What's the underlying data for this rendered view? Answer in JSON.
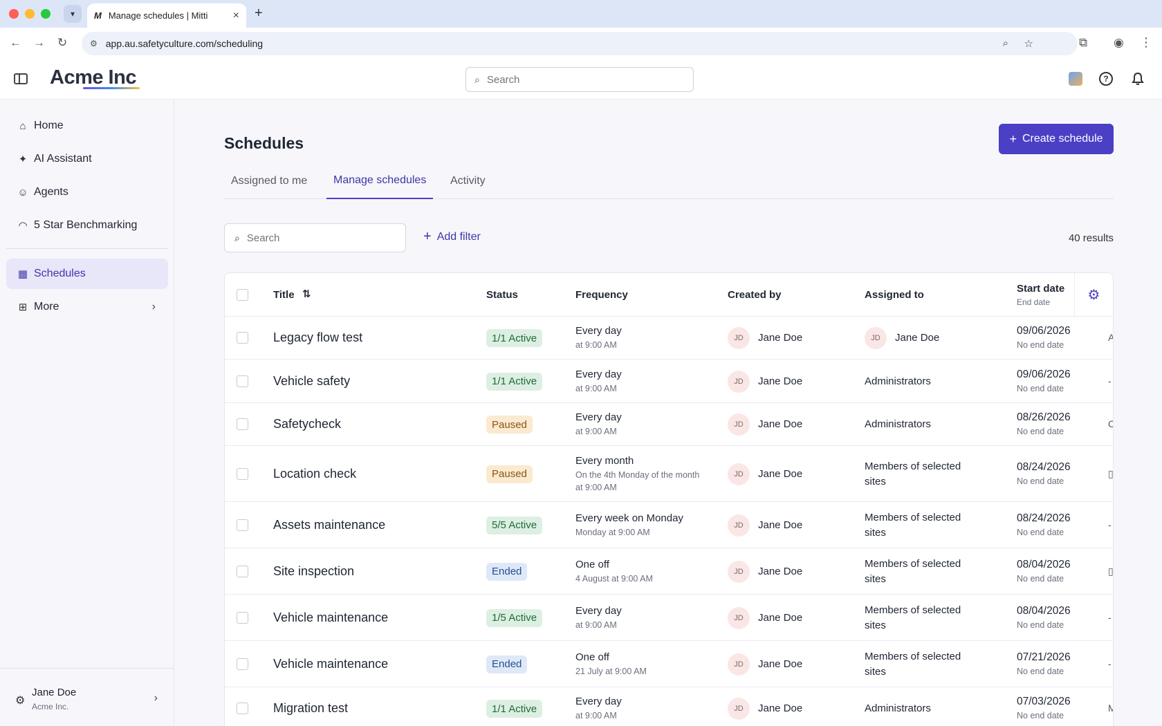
{
  "browser": {
    "tab_title": "Manage schedules | Mitti",
    "tab_favicon": "M",
    "url": "app.au.safetyculture.com/scheduling"
  },
  "app": {
    "logo": "Acme Inc",
    "search_placeholder": "Search"
  },
  "sidebar": {
    "items": [
      {
        "label": "Home",
        "icon": "home-icon"
      },
      {
        "label": "AI Assistant",
        "icon": "sparkle-icon"
      },
      {
        "label": "Agents",
        "icon": "robot-icon"
      },
      {
        "label": "5 Star Benchmarking",
        "icon": "gauge-icon"
      },
      {
        "label": "Schedules",
        "icon": "calendar-icon"
      },
      {
        "label": "More",
        "icon": "grid-icon"
      }
    ],
    "user": {
      "name": "Jane Doe",
      "org": "Acme Inc."
    }
  },
  "main": {
    "title": "Schedules",
    "create_label": "Create schedule",
    "tabs": [
      "Assigned to me",
      "Manage schedules",
      "Activity"
    ],
    "active_tab": "Manage schedules",
    "search_placeholder": "Search",
    "add_filter_label": "Add filter",
    "results": "40 results"
  },
  "table": {
    "headers": {
      "title": "Title",
      "status": "Status",
      "frequency": "Frequency",
      "created_by": "Created by",
      "assigned_to": "Assigned to",
      "start_date": "Start date",
      "end_date": "End date"
    },
    "rows": [
      {
        "title": "Legacy flow test",
        "status": "1/1 Active",
        "status_type": "active",
        "freq": "Every day",
        "freq_sub": "at 9:00 AM",
        "creator_initials": "JD",
        "creator": "Jane Doe",
        "assigned_initials": "JD",
        "assigned": "Jane Doe",
        "start": "09/06/2026",
        "end": "No end date",
        "overflow": "A"
      },
      {
        "title": "Vehicle safety",
        "status": "1/1 Active",
        "status_type": "active",
        "freq": "Every day",
        "freq_sub": "at 9:00 AM",
        "creator_initials": "JD",
        "creator": "Jane Doe",
        "assigned": "Administrators",
        "start": "09/06/2026",
        "end": "No end date",
        "overflow": "-"
      },
      {
        "title": "Safetycheck",
        "status": "Paused",
        "status_type": "paused",
        "freq": "Every day",
        "freq_sub": "at 9:00 AM",
        "creator_initials": "JD",
        "creator": "Jane Doe",
        "assigned": "Administrators",
        "start": "08/26/2026",
        "end": "No end date",
        "overflow": "C"
      },
      {
        "title": "Location check",
        "status": "Paused",
        "status_type": "paused",
        "freq": "Every month",
        "freq_sub": "On the 4th Monday of the month at 9:00 AM",
        "creator_initials": "JD",
        "creator": "Jane Doe",
        "assigned": "Members of selected sites",
        "start": "08/24/2026",
        "end": "No end date",
        "overflow": "▯"
      },
      {
        "title": "Assets maintenance",
        "status": "5/5 Active",
        "status_type": "active",
        "freq": "Every week on Monday",
        "freq_sub": "Monday at 9:00 AM",
        "creator_initials": "JD",
        "creator": "Jane Doe",
        "assigned": "Members of selected sites",
        "start": "08/24/2026",
        "end": "No end date",
        "overflow": "-"
      },
      {
        "title": "Site inspection",
        "status": "Ended",
        "status_type": "ended",
        "freq": "One off",
        "freq_sub": "4 August at 9:00 AM",
        "creator_initials": "JD",
        "creator": "Jane Doe",
        "assigned": "Members of selected sites",
        "start": "08/04/2026",
        "end": "No end date",
        "overflow": "▯"
      },
      {
        "title": "Vehicle maintenance",
        "status": "1/5 Active",
        "status_type": "active",
        "freq": "Every day",
        "freq_sub": "at 9:00 AM",
        "creator_initials": "JD",
        "creator": "Jane Doe",
        "assigned": "Members of selected sites",
        "start": "08/04/2026",
        "end": "No end date",
        "overflow": "-"
      },
      {
        "title": "Vehicle maintenance",
        "status": "Ended",
        "status_type": "ended",
        "freq": "One off",
        "freq_sub": "21 July at 9:00 AM",
        "creator_initials": "JD",
        "creator": "Jane Doe",
        "assigned": "Members of selected sites",
        "start": "07/21/2026",
        "end": "No end date",
        "overflow": "-"
      },
      {
        "title": "Migration test",
        "status": "1/1 Active",
        "status_type": "active",
        "freq": "Every day",
        "freq_sub": "at 9:00 AM",
        "creator_initials": "JD",
        "creator": "Jane Doe",
        "assigned": "Administrators",
        "start": "07/03/2026",
        "end": "No end date",
        "overflow": "M"
      }
    ]
  }
}
